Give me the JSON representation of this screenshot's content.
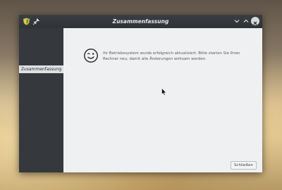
{
  "window": {
    "title": "Zusammenfassung"
  },
  "sidebar": {
    "items": [
      {
        "label": "Zusammenfassung",
        "selected": true
      }
    ]
  },
  "content": {
    "message": "Ihr Betriebssystem wurde erfolgreich aktualisiert. Bitte starten Sie Ihren Rechner neu, damit alle Änderungen wirksam werden.",
    "icon": "smiley-wink-icon",
    "close_label": "Schließen"
  },
  "colors": {
    "titlebar": "#3a3e43",
    "sidebar": "#35383c",
    "content_bg": "#eff0f1",
    "selected_item": "#dfe1e3"
  }
}
